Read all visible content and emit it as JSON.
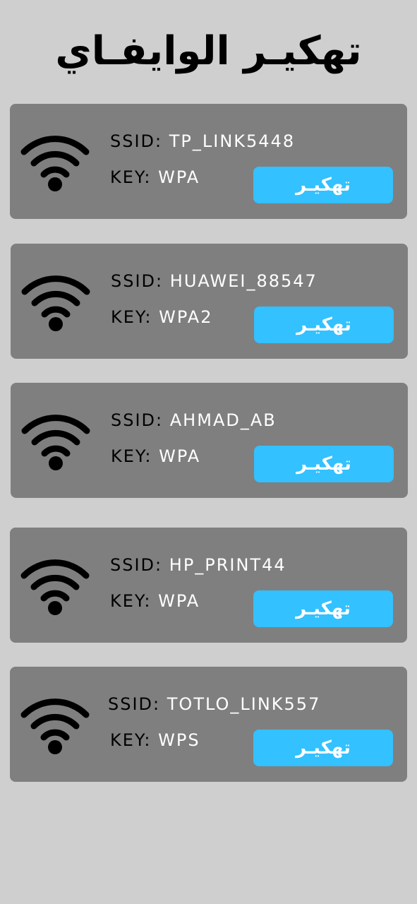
{
  "page": {
    "title": "تهكيـر الوايفـاي"
  },
  "networks": [
    {
      "ssid_label": "SSID:",
      "ssid": "TP_LINK5448",
      "key_label": "KEY:",
      "key": "WPA",
      "button": "تهكيـر"
    },
    {
      "ssid_label": "SSID:",
      "ssid": "HUAWEI_88547",
      "key_label": "KEY:",
      "key": "WPA2",
      "button": "تهكيـر"
    },
    {
      "ssid_label": "SSID:",
      "ssid": "AHMAD_AB",
      "key_label": "KEY:",
      "key": "WPA",
      "button": "تهكيـر"
    },
    {
      "ssid_label": "SSID:",
      "ssid": "HP_PRINT44",
      "key_label": "KEY:",
      "key": "WPA",
      "button": "تهكيـر"
    },
    {
      "ssid_label": "SSID:",
      "ssid": "TOTLO_LINK557",
      "key_label": "KEY:",
      "key": "WPS",
      "button": "تهكيـر"
    }
  ],
  "icons": {
    "network": "wifi-icon"
  },
  "colors": {
    "background": "#cfcfcf",
    "card": "#7f7f7f",
    "button": "#33c1ff",
    "value_text": "#ffffff",
    "label_text": "#000000"
  }
}
